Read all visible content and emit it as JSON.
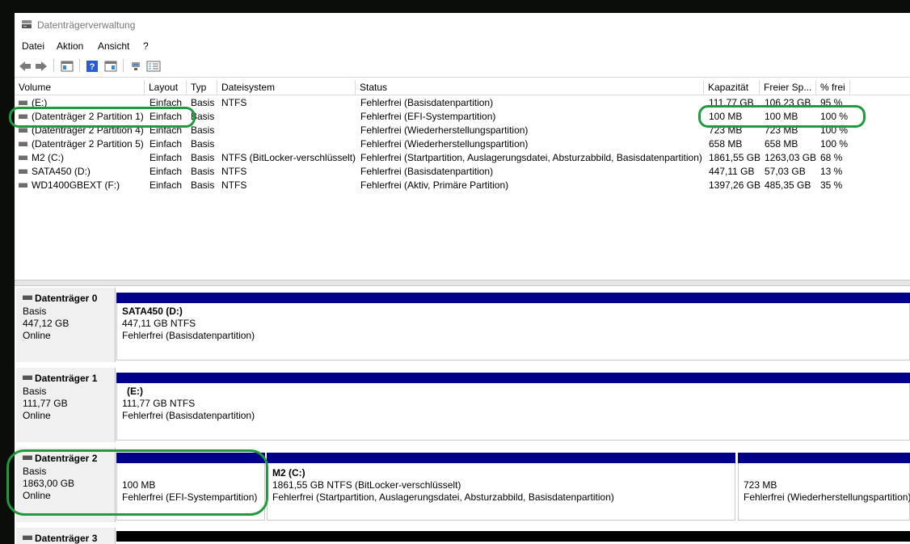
{
  "window": {
    "title": "Datenträgerverwaltung"
  },
  "menu": [
    "Datei",
    "Aktion",
    "Ansicht",
    "?"
  ],
  "toolbar": {
    "icons": [
      "back-arrow-icon",
      "forward-arrow-icon",
      "list-view-icon",
      "help-icon",
      "properties-icon",
      "connect-icon",
      "disk-list-icon"
    ]
  },
  "columns": [
    "Volume",
    "Layout",
    "Typ",
    "Dateisystem",
    "Status",
    "Kapazität",
    "Freier Sp...",
    "% frei"
  ],
  "volumes": [
    {
      "volume": "(E:)",
      "layout": "Einfach",
      "typ": "Basis",
      "fs": "NTFS",
      "status": "Fehlerfrei (Basisdatenpartition)",
      "capacity": "111,77 GB",
      "free": "106,23 GB",
      "pct": "95 %"
    },
    {
      "volume": "(Datenträger 2 Partition 1)",
      "layout": "Einfach",
      "typ": "Basis",
      "fs": "",
      "status": "Fehlerfrei (EFI-Systempartition)",
      "capacity": "100 MB",
      "free": "100 MB",
      "pct": "100 %"
    },
    {
      "volume": "(Datenträger 2 Partition 4)",
      "layout": "Einfach",
      "typ": "Basis",
      "fs": "",
      "status": "Fehlerfrei (Wiederherstellungspartition)",
      "capacity": "723 MB",
      "free": "723 MB",
      "pct": "100 %"
    },
    {
      "volume": "(Datenträger 2 Partition 5)",
      "layout": "Einfach",
      "typ": "Basis",
      "fs": "",
      "status": "Fehlerfrei (Wiederherstellungspartition)",
      "capacity": "658 MB",
      "free": "658 MB",
      "pct": "100 %"
    },
    {
      "volume": "M2 (C:)",
      "layout": "Einfach",
      "typ": "Basis",
      "fs": "NTFS (BitLocker-verschlüsselt)",
      "status": "Fehlerfrei (Startpartition, Auslagerungsdatei, Absturzabbild, Basisdatenpartition)",
      "capacity": "1861,55 GB",
      "free": "1263,03 GB",
      "pct": "68 %"
    },
    {
      "volume": "SATA450 (D:)",
      "layout": "Einfach",
      "typ": "Basis",
      "fs": "NTFS",
      "status": "Fehlerfrei (Basisdatenpartition)",
      "capacity": "447,11 GB",
      "free": "57,03 GB",
      "pct": "13 %"
    },
    {
      "volume": "WD1400GBEXT (F:)",
      "layout": "Einfach",
      "typ": "Basis",
      "fs": "NTFS",
      "status": "Fehlerfrei (Aktiv, Primäre Partition)",
      "capacity": "1397,26 GB",
      "free": "485,35 GB",
      "pct": "35 %"
    }
  ],
  "disks": [
    {
      "name": "Datenträger 0",
      "type": "Basis",
      "size": "447,12 GB",
      "state": "Online",
      "partitions": [
        {
          "title": "SATA450  (D:)",
          "line1": "447,11 GB NTFS",
          "line2": "Fehlerfrei (Basisdatenpartition)"
        }
      ]
    },
    {
      "name": "Datenträger 1",
      "type": "Basis",
      "size": "111,77 GB",
      "state": "Online",
      "partitions": [
        {
          "title": "(E:)",
          "line1": "111,77 GB NTFS",
          "line2": "Fehlerfrei (Basisdatenpartition)"
        }
      ]
    },
    {
      "name": "Datenträger 2",
      "type": "Basis",
      "size": "1863,00 GB",
      "state": "Online",
      "partitions": [
        {
          "title": "",
          "line1": "100 MB",
          "line2": "Fehlerfrei (EFI-Systempartition)"
        },
        {
          "title": "M2  (C:)",
          "line1": "1861,55 GB NTFS (BitLocker-verschlüsselt)",
          "line2": "Fehlerfrei (Startpartition, Auslagerungsdatei, Absturzabbild, Basisdatenpartition)"
        },
        {
          "title": "",
          "line1": "723 MB",
          "line2": "Fehlerfrei (Wiederherstellungspartition)"
        }
      ]
    },
    {
      "name": "Datenträger 3"
    }
  ],
  "colors": {
    "partition_bar": "#000088",
    "highlight": "#1f9a3c"
  }
}
